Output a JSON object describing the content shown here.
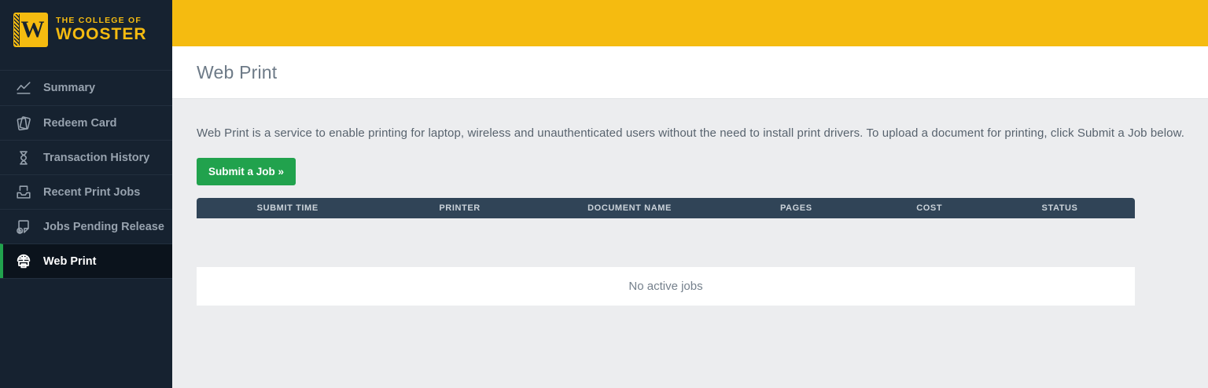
{
  "colors": {
    "brand_yellow": "#F5BB10",
    "sidebar_bg": "#162230",
    "sidebar_active_bg": "#0B131C",
    "accent_green": "#21A24D",
    "table_header_bg": "#304457",
    "content_bg": "#ECEDEF"
  },
  "brand": {
    "logo_letter": "W",
    "name_line1": "THE COLLEGE OF",
    "name_line2": "WOOSTER"
  },
  "sidebar": {
    "items": [
      {
        "label": "Summary",
        "icon": "chart-line-icon",
        "active": false
      },
      {
        "label": "Redeem Card",
        "icon": "cards-icon",
        "active": false
      },
      {
        "label": "Transaction History",
        "icon": "hourglass-icon",
        "active": false
      },
      {
        "label": "Recent Print Jobs",
        "icon": "inbox-tray-icon",
        "active": false
      },
      {
        "label": "Jobs Pending Release",
        "icon": "document-clock-icon",
        "active": false
      },
      {
        "label": "Web Print",
        "icon": "globe-printer-icon",
        "active": true
      }
    ]
  },
  "page": {
    "title": "Web Print"
  },
  "web_print": {
    "description": "Web Print is a service to enable printing for laptop, wireless and unauthenticated users without the need to install print drivers. To upload a document for printing, click Submit a Job below.",
    "submit_button_label": "Submit a Job »",
    "jobs_table": {
      "columns": [
        "SUBMIT TIME",
        "PRINTER",
        "DOCUMENT NAME",
        "PAGES",
        "COST",
        "STATUS"
      ],
      "rows": [],
      "empty_message": "No active jobs"
    }
  }
}
